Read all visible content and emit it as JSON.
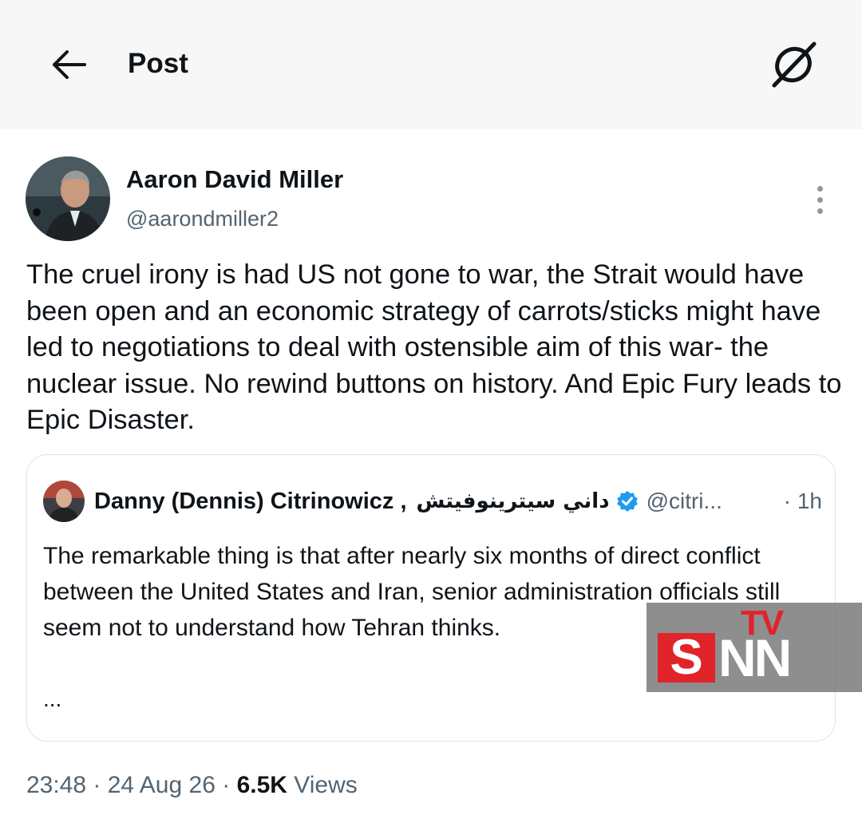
{
  "header": {
    "title": "Post",
    "back_icon": "arrow-left-icon",
    "grok_icon": "grok-icon"
  },
  "post": {
    "author_name": "Aaron David Miller",
    "author_handle": "@aarondmiller2",
    "more_icon": "more-vertical-icon",
    "text": "The cruel irony is had US  not gone to war, the Strait would have been open and an economic strategy of carrots/sticks might have led to negotiations to deal with ostensible aim of this war- the nuclear issue. No rewind buttons on history. And Epic Fury leads to Epic Disaster."
  },
  "quote": {
    "author_name": "Danny (Dennis) Citrinowicz ,",
    "author_name_arabic": "داني سيترينوفيتش",
    "verified_icon": "verified-badge-icon",
    "verified_color": "#1d9bf0",
    "handle": "@citri...",
    "separator": "·",
    "time": "1h",
    "text": "The remarkable thing is that after nearly six months of direct conflict between the United States and Iran, senior administration officials still seem not to understand how Tehran thinks.",
    "more": "..."
  },
  "meta": {
    "time": "23:48",
    "sep1": " · ",
    "date": "24 Aug 26",
    "sep2": " · ",
    "views_count": "6.5K",
    "views_label": " Views"
  },
  "watermark": {
    "tv": "TV",
    "s": "S",
    "nn": "NN",
    "accent_color": "#e0242a"
  }
}
